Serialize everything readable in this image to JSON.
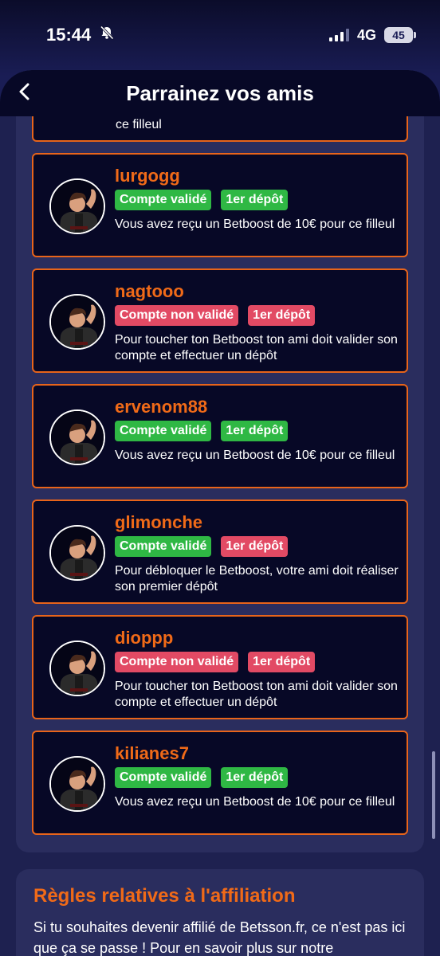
{
  "status_bar": {
    "time": "15:44",
    "network": "4G",
    "battery": "45"
  },
  "header": {
    "title": "Parrainez vos amis"
  },
  "partial_card": {
    "description": "ce filleul"
  },
  "referrals": [
    {
      "name": "lurgogg",
      "account_badge": "Compte validé",
      "account_status": "ok",
      "deposit_badge": "1er dépôt",
      "deposit_status": "ok",
      "description": "Vous avez reçu un Betboost de 10€ pour ce filleul"
    },
    {
      "name": "nagtooo",
      "account_badge": "Compte non validé",
      "account_status": "ko",
      "deposit_badge": "1er dépôt",
      "deposit_status": "ko",
      "description": "Pour toucher ton Betboost ton ami doit valider son compte et effectuer un dépôt"
    },
    {
      "name": "ervenom88",
      "account_badge": "Compte validé",
      "account_status": "ok",
      "deposit_badge": "1er dépôt",
      "deposit_status": "ok",
      "description": "Vous avez reçu un Betboost de 10€ pour ce filleul"
    },
    {
      "name": "glimonche",
      "account_badge": "Compte validé",
      "account_status": "ok",
      "deposit_badge": "1er dépôt",
      "deposit_status": "ko",
      "description": "Pour débloquer le Betboost, votre ami doit réaliser son premier dépôt"
    },
    {
      "name": "dioppp",
      "account_badge": "Compte non validé",
      "account_status": "ko",
      "deposit_badge": "1er dépôt",
      "deposit_status": "ko",
      "description": "Pour toucher ton Betboost ton ami doit valider son compte et effectuer un dépôt"
    },
    {
      "name": "kilianes7",
      "account_badge": "Compte validé",
      "account_status": "ok",
      "deposit_badge": "1er dépôt",
      "deposit_status": "ok",
      "description": "Vous avez reçu un Betboost de 10€ pour ce filleul"
    }
  ],
  "rules": {
    "title": "Règles relatives à l'affiliation",
    "text": "Si tu souhaites devenir affilié de Betsson.fr, ce n'est pas ici que ça se passe ! Pour en savoir plus sur notre"
  },
  "colors": {
    "accent_orange": "#f06a18",
    "validated_green": "#2fb844",
    "not_validated_red": "#e24a64",
    "card_background": "#070826"
  },
  "icons": {
    "back": "chevron-left-icon",
    "silent": "bell-slash-icon",
    "signal": "cellular-signal-icon",
    "battery": "battery-icon",
    "avatar": "avatar-character-icon"
  }
}
